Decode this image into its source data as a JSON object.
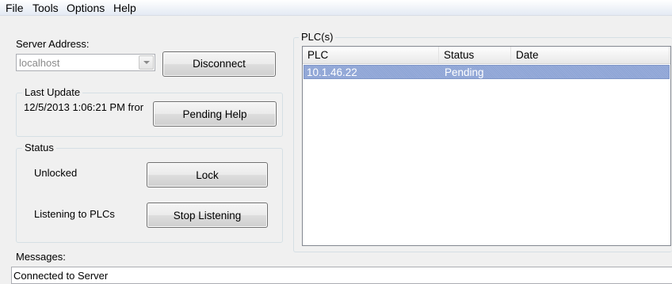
{
  "menu": [
    "File",
    "Tools",
    "Options",
    "Help"
  ],
  "server": {
    "label": "Server Address:",
    "value": "localhost",
    "disconnect_label": "Disconnect"
  },
  "last_update": {
    "title": "Last Update",
    "text": "12/5/2013 1:06:21 PM fror",
    "pending_help_label": "Pending Help"
  },
  "status": {
    "title": "Status",
    "lock_state": "Unlocked",
    "lock_label": "Lock",
    "listen_state": "Listening to PLCs",
    "stop_listening_label": "Stop Listening"
  },
  "plcs": {
    "title": "PLC(s)",
    "columns": [
      "PLC",
      "Status",
      "Date"
    ],
    "rows": [
      {
        "plc": "10.1.46.22",
        "status": "Pending",
        "date": ""
      }
    ]
  },
  "messages": {
    "label": "Messages:",
    "text": "Connected to Server"
  },
  "colors": {
    "selection": "#98addb",
    "window_bg": "#f0f0f0"
  }
}
